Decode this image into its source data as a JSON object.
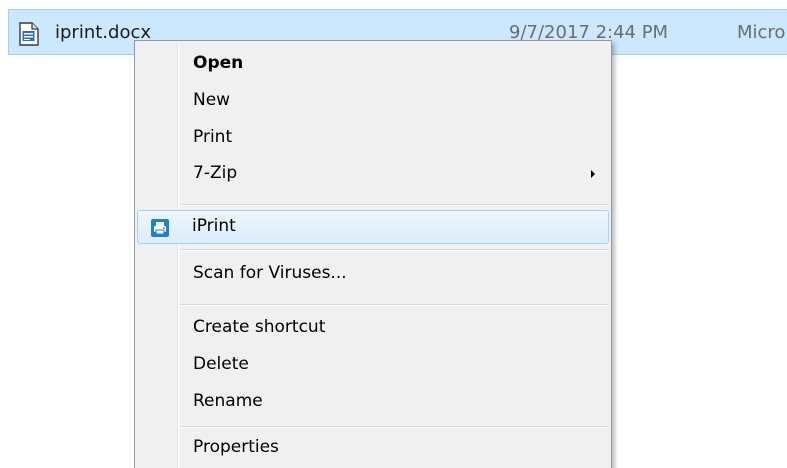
{
  "file": {
    "name": "iprint.docx",
    "date_modified": "9/7/2017 2:44 PM",
    "type": "Micro"
  },
  "context_menu": {
    "items": [
      {
        "label": "Open",
        "bold": true
      },
      {
        "label": "New"
      },
      {
        "label": "Print"
      },
      {
        "label": "7-Zip",
        "submenu": true
      },
      {
        "label": "iPrint",
        "icon": "printer-icon",
        "highlighted": true
      },
      {
        "label": "Scan for Viruses..."
      },
      {
        "label": "Create shortcut"
      },
      {
        "label": "Delete"
      },
      {
        "label": "Rename"
      },
      {
        "label": "Properties"
      }
    ]
  },
  "colors": {
    "selection_bg": "#cce8ff",
    "selection_border": "#99d1ff",
    "menu_bg": "#f0f0f0",
    "highlight_border": "#a6cff2",
    "icon_blue": "#1e7fd6"
  }
}
